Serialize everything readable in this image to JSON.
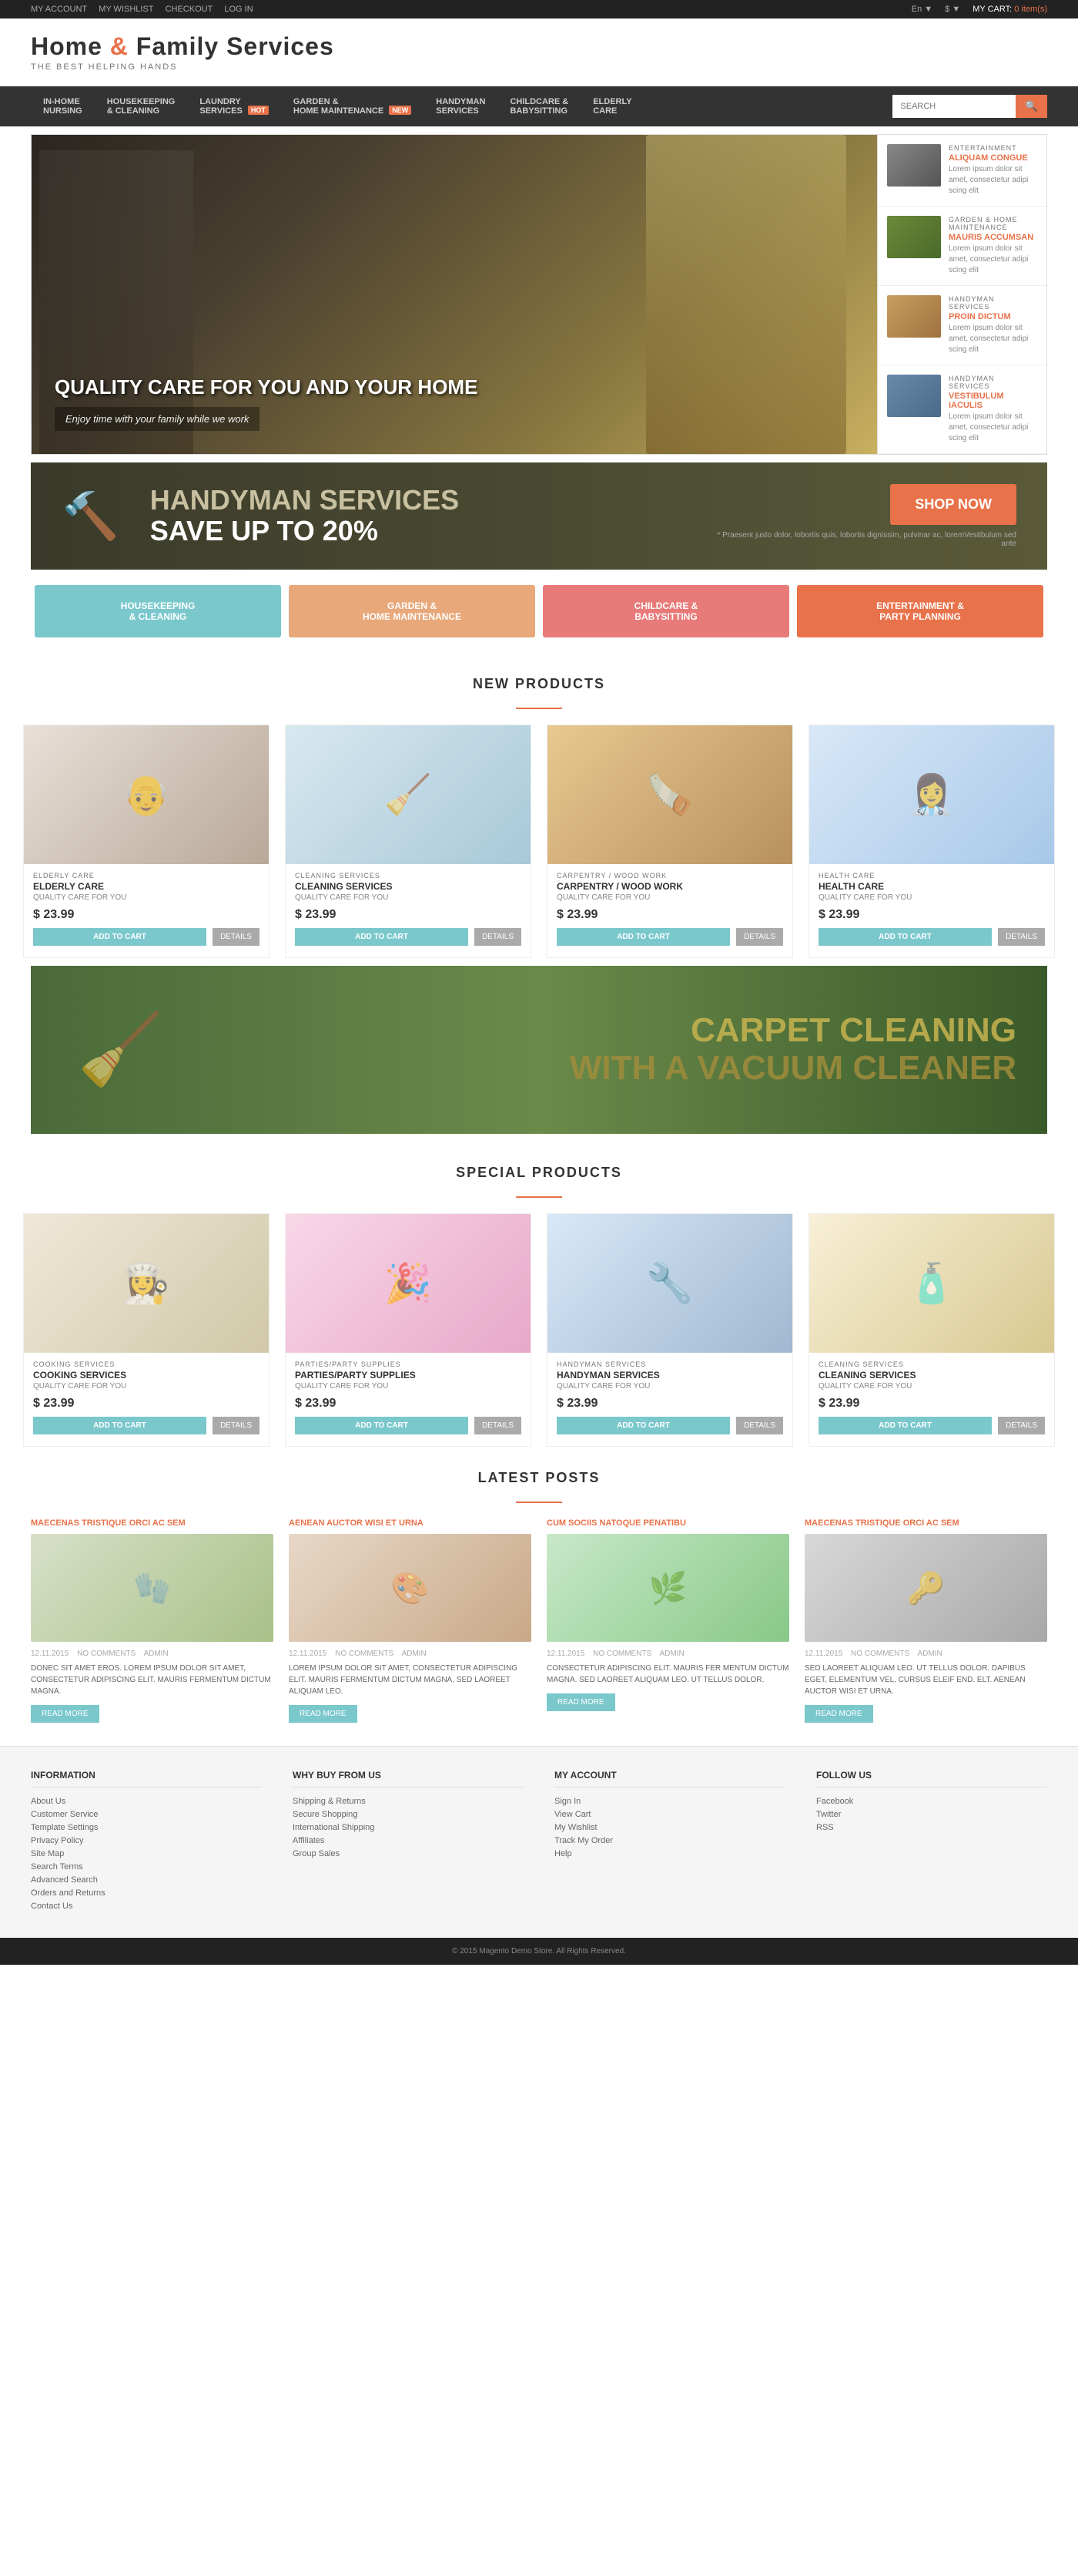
{
  "topbar": {
    "links": [
      "MY ACCOUNT",
      "MY WISHLIST",
      "CHECKOUT",
      "LOG IN"
    ],
    "lang": "En",
    "currency": "$",
    "cart_label": "MY CART:",
    "cart_items": "0 item(s)"
  },
  "header": {
    "logo_line1": "Home & Family Services",
    "tagline": "THE BEST HELPING HANDS"
  },
  "nav": {
    "items": [
      {
        "label": "IN-HOME\nNURSING",
        "badge": null
      },
      {
        "label": "HOUSEKEEPING\n& CLEANING",
        "badge": null
      },
      {
        "label": "LAUNDRY\nSERVICES",
        "badge": "HOT"
      },
      {
        "label": "GARDEN &\nHOME MAINTENANCE",
        "badge": "NEW"
      },
      {
        "label": "HANDYMAN\nSERVICES",
        "badge": null
      },
      {
        "label": "CHILDCARE &\nBABYSITTING",
        "badge": null
      },
      {
        "label": "ELDERLY\nCARE",
        "badge": null
      }
    ],
    "search_placeholder": "SEARCH"
  },
  "hero": {
    "headline": "QUALITY CARE FOR YOU AND YOUR HOME",
    "subtext": "Enjoy time with your family while we work",
    "sidebar": [
      {
        "cat": "ENTERTAINMENT",
        "title": "ALIQUAM CONGUE",
        "desc": "Lorem ipsum dolor sit amet, consectetur adipi scing elit"
      },
      {
        "cat": "GARDEN & HOME MAINTENANCE",
        "title": "MAURIS ACCUMSAN",
        "desc": "Lorem ipsum dolor sit amet, consectetur adipi scing elit"
      },
      {
        "cat": "HANDYMAN SERVICES",
        "title": "PROIN DICTUM",
        "desc": "Lorem ipsum dolor sit amet, consectetur adipi scing elit"
      },
      {
        "cat": "HANDYMAN SERVICES",
        "title": "VESTIBULUM IACULIS",
        "desc": "Lorem ipsum dolor sit amet, consectetur adipi scing elit"
      }
    ]
  },
  "banner": {
    "line1": "HANDYMAN SERVICES",
    "line2": "SAVE up to 20%",
    "sub": "* Praesent justo dolor, lobortis quis, lobortis dignissim, pulvinar ac, loremVestibulum sed ante",
    "btn": "Shop Now"
  },
  "categories": [
    {
      "label": "HOUSEKEEPING\n& CLEANING"
    },
    {
      "label": "GARDEN &\nHOME MAINTENANCE"
    },
    {
      "label": "CHILDCARE &\nBABYSITTING"
    },
    {
      "label": "ENTERTAINMENT &\nPARTY PLANNING"
    }
  ],
  "new_products": {
    "title": "NEW PRODUCTS",
    "items": [
      {
        "cat": "ELDERLY CARE",
        "name": "ELDERLY CARE",
        "desc": "QUALITY CARE FOR YOU",
        "price": "$ 23.99",
        "btn_cart": "ADD TO CART",
        "btn_details": "Details"
      },
      {
        "cat": "CLEANING SERVICES",
        "name": "CLEANING SERVICES",
        "desc": "QUALITY CARE FOR YOU",
        "price": "$ 23.99",
        "btn_cart": "ADD TO CART",
        "btn_details": "Details"
      },
      {
        "cat": "CARPENTRY / WOOD WORK",
        "name": "CARPENTRY / WOOD WORK",
        "desc": "QUALITY CARE FOR YOU",
        "price": "$ 23.99",
        "btn_cart": "ADD TO CART",
        "btn_details": "Details"
      },
      {
        "cat": "HEALTH CARE",
        "name": "HEALTH CARE",
        "desc": "QUALITY CARE FOR YOU",
        "price": "$ 23.99",
        "btn_cart": "ADD TO CART",
        "btn_details": "Details"
      }
    ]
  },
  "carpet_banner": {
    "line1": "CARPET CLEANING",
    "line2": "WITH A VACUUM CLEANER"
  },
  "special_products": {
    "title": "SPECIAL PRODUCTS",
    "items": [
      {
        "cat": "COOKING SERVICES",
        "name": "COOKING SERVICES",
        "desc": "QUALITY CARE FOR YOU",
        "price": "$ 23.99",
        "btn_cart": "ADD TO CART",
        "btn_details": "Details"
      },
      {
        "cat": "PARTIES/PARTY SUPPLIES",
        "name": "PARTIES/PARTY SUPPLIES",
        "desc": "QUALITY CARE FOR YOU",
        "price": "$ 23.99",
        "btn_cart": "ADD TO CART",
        "btn_details": "Details"
      },
      {
        "cat": "HANDYMAN SERVICES",
        "name": "HANDYMAN SERVICES",
        "desc": "QUALITY CARE FOR YOU",
        "price": "$ 23.99",
        "btn_cart": "ADD TO CART",
        "btn_details": "Details"
      },
      {
        "cat": "CLEANING SERVICES",
        "name": "CLEANING SERVICES",
        "desc": "QUALITY CARE FOR YOU",
        "price": "$ 23.99",
        "btn_cart": "ADD TO CART",
        "btn_details": "Details"
      }
    ]
  },
  "latest_posts": {
    "title": "LATEST POSTS",
    "items": [
      {
        "title": "MAECENAS TRISTIQUE ORCI AC SEM",
        "date": "12.11.2015",
        "comments": "NO COMMENTS",
        "author": "ADMIN",
        "excerpt": "DONEC SIT AMET EROS. LOREM IPSUM DOLOR SIT AMET, CONSECTETUR ADIPISCING ELIT. MAURIS FERMENTUM DICTUM MAGNA.",
        "btn": "READ MORE"
      },
      {
        "title": "AENEAN AUCTOR WISI ET URNA",
        "date": "12.11.2015",
        "comments": "NO COMMENTS",
        "author": "ADMIN",
        "excerpt": "LOREM IPSUM DOLOR SIT AMET, CONSECTETUR ADIPISCING ELIT. MAURIS FERMENTUM DICTUM MAGNA, SED LAOREET ALIQUAM LEO.",
        "btn": "READ MORE"
      },
      {
        "title": "CUM SOCIIS NATOQUE PENATIBU",
        "date": "12.11.2015",
        "comments": "NO COMMENTS",
        "author": "ADMIN",
        "excerpt": "CONSECTETUR ADIPISCING ELIT. MAURIS FER MENTUM DICTUM MAGNA. SED LAOREET ALIQUAM LEO. UT TELLUS DOLOR.",
        "btn": "READ MORE"
      },
      {
        "title": "MAECENAS TRISTIQUE ORCI AC SEM",
        "date": "12.11.2015",
        "comments": "NO COMMENTS",
        "author": "ADMIN",
        "excerpt": "SED LAOREET ALIQUAM LEO. UT TELLUS DOLOR. DAPIBUS EGET, ELEMENTUM VEL, CURSUS ELEIF END. ELT. AENEAN AUCTOR WISI ET URNA.",
        "btn": "READ MORE"
      }
    ]
  },
  "footer": {
    "info": {
      "title": "INFORMATION",
      "links": [
        "About Us",
        "Customer Service",
        "Template Settings",
        "Privacy Policy",
        "Site Map",
        "Search Terms",
        "Advanced Search",
        "Orders and Returns",
        "Contact Us"
      ]
    },
    "why": {
      "title": "WHY BUY FROM US",
      "links": [
        "Shipping & Returns",
        "Secure Shopping",
        "International Shipping",
        "Affiliates",
        "Group Sales"
      ]
    },
    "account": {
      "title": "MY ACCOUNT",
      "links": [
        "Sign In",
        "View Cart",
        "My Wishlist",
        "Track My Order",
        "Help"
      ]
    },
    "follow": {
      "title": "FOLLOW US",
      "links": [
        "Facebook",
        "Twitter",
        "RSS"
      ]
    },
    "copyright": "© 2015 Magento Demo Store. All Rights Reserved."
  }
}
